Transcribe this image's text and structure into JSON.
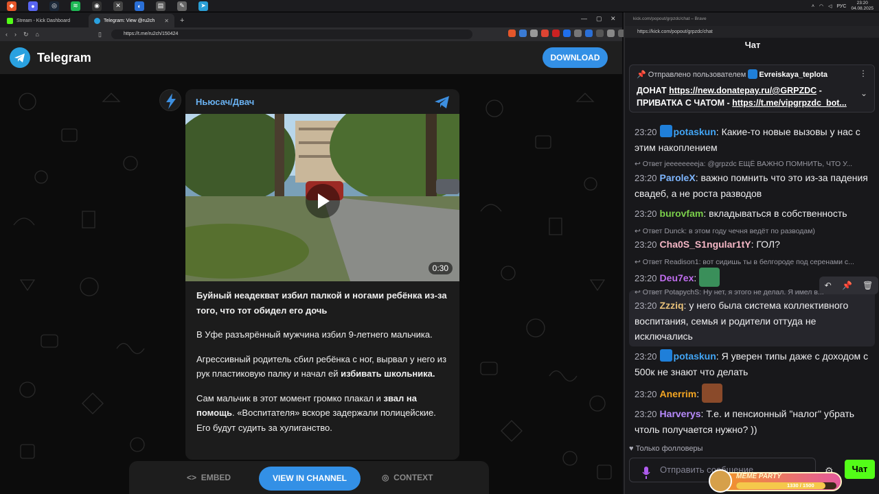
{
  "taskbar": {
    "time": "23:20",
    "date": "04.08.2025",
    "lang": "РУС"
  },
  "left_browser": {
    "tabs": [
      {
        "label": "Stream - Kick Dashboard"
      },
      {
        "label": "Telegram: View @ru2ch"
      }
    ],
    "url": "https://t.me/ru2ch/150424"
  },
  "telegram": {
    "brand": "Telegram",
    "download_label": "DOWNLOAD",
    "channel_name": "Ньюсач/Двач",
    "video_duration": "0:30",
    "headline": "Буйный неадекват избил палкой и ногами ребёнка из-за того, что тот обидел его дочь",
    "p1": "В Уфе разъярённый мужчина избил 9-летнего мальчика.",
    "p2a": "Агрессивный родитель сбил ребёнка с ног, вырвал у него из рук пластиковую палку и начал ей ",
    "p2b": "избивать школьника.",
    "p3a": "Сам мальчик в этот момент громко плакал и ",
    "p3b": "звал на помощь",
    "p3c": ". «Воспитателя» вскоре задержали полицейские. Его будут судить за хулиганство.",
    "embed_label": "EMBED",
    "view_label": "VIEW IN CHANNEL",
    "context_label": "CONTEXT"
  },
  "right_browser": {
    "title": "kick.com/popout/grpzdc/chat – Brave",
    "url": "https://kick.com/popout/grpzdc/chat",
    "chat_title": "Чат"
  },
  "pinned": {
    "prefix": "Отправлено пользователем",
    "user": "Evreiskaya_teplota",
    "line1_prefix": "ДОНАТ ",
    "line1_link": "https://new.donatepay.ru/@GRPZDC",
    "line1_suffix": " -",
    "line2_prefix": "ПРИВАТКА С ЧАТОМ - ",
    "line2_link": "https://t.me/vipgrpzdc_bot..."
  },
  "messages": [
    {
      "time": "23:20",
      "user": "potaskun",
      "color": "#42a5f5",
      "text": "Какие-то новые вызовы у нас с этим накоплением"
    },
    {
      "reply": "Ответ jeeeeeeeeja: @grpzdc ЕЩЁ ВАЖНО ПОМНИТЬ, ЧТО У...",
      "time": "23:20",
      "user": "ParoleX",
      "color": "#7eb6ff",
      "text": "важно помнить что это из-за падения свадеб, а не роста разводов"
    },
    {
      "time": "23:20",
      "user": "burovfam",
      "color": "#7bd04b",
      "text": "вкладываться в собственность"
    },
    {
      "reply": "Ответ Dunck: в этом году чечня ведёт по разводам)",
      "time": "23:20",
      "user": "Cha0S_S1ngular1tY",
      "color": "#f6b7c6",
      "text": "ГОЛ?"
    },
    {
      "reply": "Ответ Readison1: вот сидишь ты в белгороде под серенами с...",
      "time": "23:20",
      "user": "Deu7ex",
      "color": "#c16ef0",
      "text": ""
    },
    {
      "reply": "Ответ PotapychS: Ну нет, я этого не делал. Я имел в...",
      "time": "23:20",
      "user": "Zzziq",
      "color": "#e8c17a",
      "text": "у него была система коллективного воспитания, семья и родители оттуда не исключались"
    },
    {
      "time": "23:20",
      "user": "potaskun",
      "color": "#42a5f5",
      "text": "Я уверен типы даже с доходом с 500к не знают что делать"
    },
    {
      "time": "23:20",
      "user": "Anerrim",
      "color": "#f5a623",
      "text": ""
    },
    {
      "time": "23:20",
      "user": "Harverys",
      "color": "#b98cff",
      "text": "Т.е. и пенсионный \"налог\" убрать чтоль получается нужно? ))"
    }
  ],
  "chat_footer": {
    "followers_only": "Только фолловеры",
    "input_placeholder": "Отправить сообщение",
    "send_label": "Чат"
  },
  "meme_party": {
    "title": "MEME PARTY",
    "count": "1330 / 1500",
    "progress": 0.887
  },
  "colors": {
    "telegram_blue": "#3390e6",
    "kick_green": "#53fc18"
  }
}
